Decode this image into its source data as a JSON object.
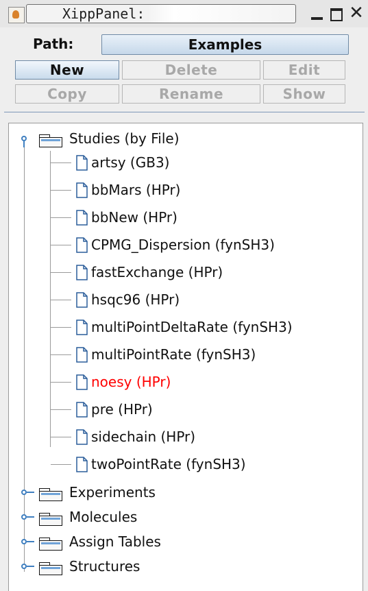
{
  "window": {
    "title": "XippPanel:",
    "colors": {
      "selected_text": "#ff0000",
      "tree_line": "#9a9a9a",
      "toggle": "#3f7fc0",
      "button_gradient": "#c9dbec"
    }
  },
  "path": {
    "label": "Path:",
    "value": "Examples"
  },
  "buttons": {
    "new": "New",
    "delete": "Delete",
    "edit": "Edit",
    "copy": "Copy",
    "rename": "Rename",
    "show": "Show"
  },
  "tree": {
    "studies": {
      "label": "Studies (by File)",
      "expanded": true,
      "items": [
        "artsy (GB3)",
        "bbMars (HPr)",
        "bbNew (HPr)",
        "CPMG_Dispersion (fynSH3)",
        "fastExchange (HPr)",
        "hsqc96 (HPr)",
        "multiPointDeltaRate (fynSH3)",
        "multiPointRate (fynSH3)",
        "noesy (HPr)",
        "pre (HPr)",
        "sidechain (HPr)",
        "twoPointRate (fynSH3)"
      ],
      "selected_item": "noesy (HPr)"
    },
    "experiments": {
      "label": "Experiments",
      "expanded": false
    },
    "molecules": {
      "label": "Molecules",
      "expanded": false
    },
    "assign_tables": {
      "label": "Assign Tables",
      "expanded": false
    },
    "structures": {
      "label": "Structures",
      "expanded": false
    }
  }
}
